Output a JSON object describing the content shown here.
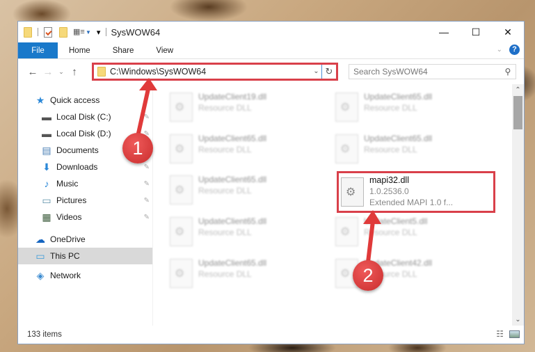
{
  "window": {
    "title": "SysWOW64",
    "controls": {
      "minimize": "—",
      "maximize": "☐",
      "close": "✕"
    }
  },
  "quick_access_toolbar": {
    "icons": [
      "folder-icon",
      "properties-icon",
      "new-folder-icon",
      "view-options-icon",
      "customize-arrow-icon"
    ],
    "customize_glyph": "▾"
  },
  "ribbon": {
    "tabs": [
      {
        "label": "File",
        "active": true
      },
      {
        "label": "Home"
      },
      {
        "label": "Share"
      },
      {
        "label": "View"
      }
    ],
    "expand_glyph": "⌄",
    "help_glyph": "?"
  },
  "navigation": {
    "back_glyph": "←",
    "forward_glyph": "→",
    "recent_glyph": "⌄",
    "up_glyph": "↑",
    "address": "C:\\Windows\\SysWOW64",
    "address_dropdown_glyph": "⌄",
    "refresh_glyph": "↻",
    "search_placeholder": "Search SysWOW64",
    "search_glyph": "⚲"
  },
  "sidebar": {
    "quick_access": {
      "label": "Quick access",
      "icon": "★"
    },
    "items": [
      {
        "label": "Local Disk (C:)",
        "icon": "▬",
        "pinned": true
      },
      {
        "label": "Local Disk (D:)",
        "icon": "▬",
        "pinned": true
      },
      {
        "label": "Documents",
        "icon": "▤",
        "pinned": true
      },
      {
        "label": "Downloads",
        "icon": "⬇",
        "pinned": true
      },
      {
        "label": "Music",
        "icon": "♪",
        "pinned": true
      },
      {
        "label": "Pictures",
        "icon": "▭",
        "pinned": true
      },
      {
        "label": "Videos",
        "icon": "▦",
        "pinned": true
      }
    ],
    "pin_glyph": "📌",
    "onedrive": {
      "label": "OneDrive",
      "icon": "☁"
    },
    "this_pc": {
      "label": "This PC",
      "icon": "▭",
      "selected": true
    },
    "network": {
      "label": "Network",
      "icon": "◈"
    }
  },
  "files": [
    {
      "name": "UpdateClient19.dll",
      "desc": "Resource DLL",
      "blurred": true
    },
    {
      "name": "UpdateClient65.dll",
      "desc": "Resource DLL",
      "blurred": true
    },
    {
      "name": "UpdateClient65.dll",
      "desc": "Resource DLL",
      "blurred": true
    },
    {
      "name": "UpdateClient65.dll",
      "desc": "Resource DLL",
      "blurred": true
    },
    {
      "name": "UpdateClient65.dll",
      "desc": "Resource DLL",
      "blurred": true
    },
    {
      "name": "mapi32.dll",
      "version": "1.0.2536.0",
      "desc": "Extended MAPI 1.0 f...",
      "highlighted": true
    },
    {
      "name": "UpdateClient65.dll",
      "desc": "Resource DLL",
      "blurred": true
    },
    {
      "name": "UpdateClient5.dll",
      "desc": "Resource DLL",
      "blurred": true
    },
    {
      "name": "UpdateClient65.dll",
      "desc": "Resource DLL",
      "blurred": true
    },
    {
      "name": "UpdateClient42.dll",
      "desc": "Resource DLL",
      "blurred": true
    }
  ],
  "status": {
    "item_count": "133 items"
  },
  "scrollbar": {
    "up_glyph": "⌃",
    "down_glyph": "⌄"
  },
  "annotations": [
    {
      "number": "1",
      "target": "address-bar"
    },
    {
      "number": "2",
      "target": "mapi32.dll"
    }
  ],
  "colors": {
    "accent": "#1979ca",
    "annotation_red": "#d9404a",
    "selection_gray": "#d9d9d9"
  }
}
